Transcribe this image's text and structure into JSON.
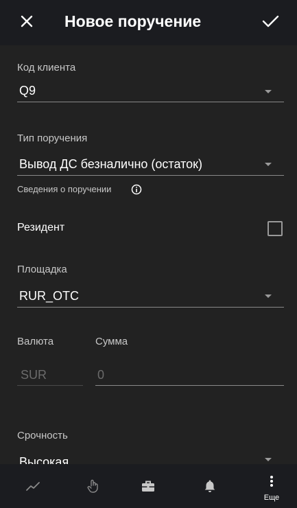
{
  "header": {
    "title": "Новое поручение",
    "close_icon": "close-icon",
    "confirm_icon": "check-icon"
  },
  "form": {
    "client_code": {
      "label": "Код клиента",
      "value": "Q9"
    },
    "order_type": {
      "label": "Тип поручения",
      "value": "Вывод ДС безналично (остаток)"
    },
    "order_info": {
      "label": "Сведения о поручении",
      "icon": "info-icon"
    },
    "resident": {
      "label": "Резидент",
      "checked": false
    },
    "venue": {
      "label": "Площадка",
      "value": "RUR_OTC"
    },
    "currency": {
      "label": "Валюта",
      "value": "SUR"
    },
    "amount": {
      "label": "Сумма",
      "value": "0"
    },
    "urgency": {
      "label": "Срочность",
      "value": "Высокая"
    }
  },
  "bottom_nav": {
    "items": [
      {
        "icon": "chart-line-icon"
      },
      {
        "icon": "hand-pointer-icon"
      },
      {
        "icon": "briefcase-icon"
      },
      {
        "icon": "bell-icon"
      },
      {
        "icon": "more-vertical-icon",
        "label": "Еще"
      }
    ]
  }
}
